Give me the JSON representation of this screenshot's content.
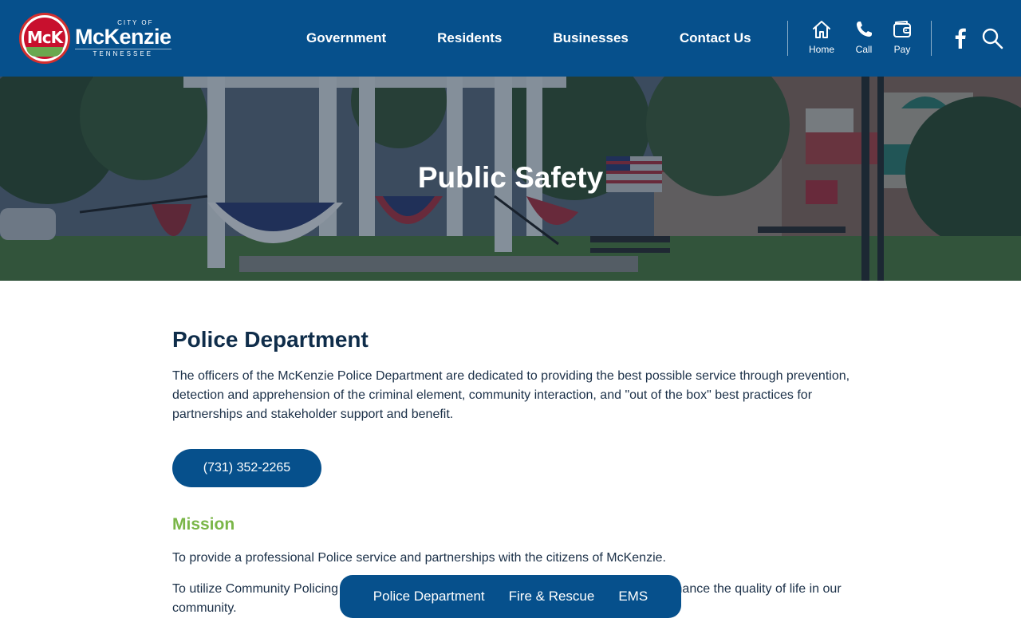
{
  "logo": {
    "city_of": "CITY OF",
    "name": "McKenzie",
    "state": "TENNESSEE",
    "monogram": "McK"
  },
  "nav": {
    "items": [
      "Government",
      "Residents",
      "Businesses",
      "Contact Us"
    ]
  },
  "quick_links": [
    {
      "label": "Home",
      "icon": "home-icon"
    },
    {
      "label": "Call",
      "icon": "phone-icon"
    },
    {
      "label": "Pay",
      "icon": "wallet-icon"
    }
  ],
  "social": {
    "icon": "facebook-icon"
  },
  "search": {
    "icon": "search-icon"
  },
  "hero": {
    "title": "Public Safety"
  },
  "content": {
    "heading": "Police Department",
    "intro": "The officers of the McKenzie Police Department are dedicated to providing the best possible service through prevention, detection and apprehension of the criminal element, community interaction, and \"out of the box\" best practices for partnerships and stakeholder support and benefit.",
    "phone": "(731) 352-2265",
    "mission_heading": "Mission",
    "mission_p1": "To provide a professional Police service and partnerships with the citizens of McKenzie.",
    "mission_p2": "To utilize Community Policing to identify community problems and solutions in order to enhance the quality of life in our community."
  },
  "subnav": {
    "items": [
      "Police Department",
      "Fire & Rescue",
      "EMS"
    ]
  },
  "colors": {
    "brand_blue": "#06508c",
    "mission_green": "#7ab648",
    "heading_navy": "#0f2d4a"
  }
}
